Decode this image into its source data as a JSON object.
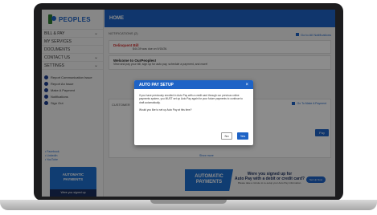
{
  "brand": {
    "name": "PEOPLES",
    "primary_color": "#1e63c6",
    "dark_color": "#1b2f5e",
    "alert_color": "#d32f2f"
  },
  "header": {
    "title": "HOME"
  },
  "sidebar": {
    "items": [
      {
        "label": "BILL & PAY",
        "has_chevron": true
      },
      {
        "label": "MY SERVICES",
        "has_chevron": false
      },
      {
        "label": "DOCUMENTS",
        "has_chevron": false
      },
      {
        "label": "CONTACT US",
        "has_chevron": true
      },
      {
        "label": "SETTINGS",
        "has_chevron": true
      }
    ],
    "actions": [
      {
        "label": "Report Communication Issue"
      },
      {
        "label": "Report An Issue"
      },
      {
        "label": "Make A Payment"
      },
      {
        "label": "Notifications"
      },
      {
        "label": "Sign Out"
      }
    ],
    "social": [
      "Facebook",
      "LinkedIn",
      "YouTube"
    ],
    "banner": {
      "line1": "AUTOMATIC",
      "line2": "PAYMENTS",
      "footer": "Were you signed up"
    }
  },
  "main": {
    "notifications_label": "NOTIFICATIONS (2)",
    "go_to_all": "Go to All Notifications",
    "delinquent_title": "Delinquent Bill",
    "delinquent_text": "$44.39 was due on 9/15/26.",
    "welcome_title": "Welcome to OurPeoples!",
    "welcome_text": "View and pay your bill, sign up for auto pay, schedule a payment, and more!",
    "customer_label": "CUSTOMER",
    "make_payment_link": "Go To Make A Payment",
    "pay_button": "Pay",
    "show_more": "Show more"
  },
  "promo": {
    "left1": "AUTOMATIC",
    "left2": "PAYMENTS",
    "line1": "Were you signed up for",
    "line2": "Auto Pay with a debit or credit card?",
    "line3": "Please take a minute to re-setup your Auto Pay information.",
    "button": "Set Up Now"
  },
  "modal": {
    "title": "AUTO PAY SETUP",
    "close": "×",
    "body": "If you have previously enrolled in Auto Pay with a credit card through our previous online payments system, you MUST set up Auto Pay again for your future payments to continue to draft automatically.",
    "question": "Would you like to set up Auto Pay at this time?",
    "no_label": "No",
    "yes_label": "Yes"
  }
}
